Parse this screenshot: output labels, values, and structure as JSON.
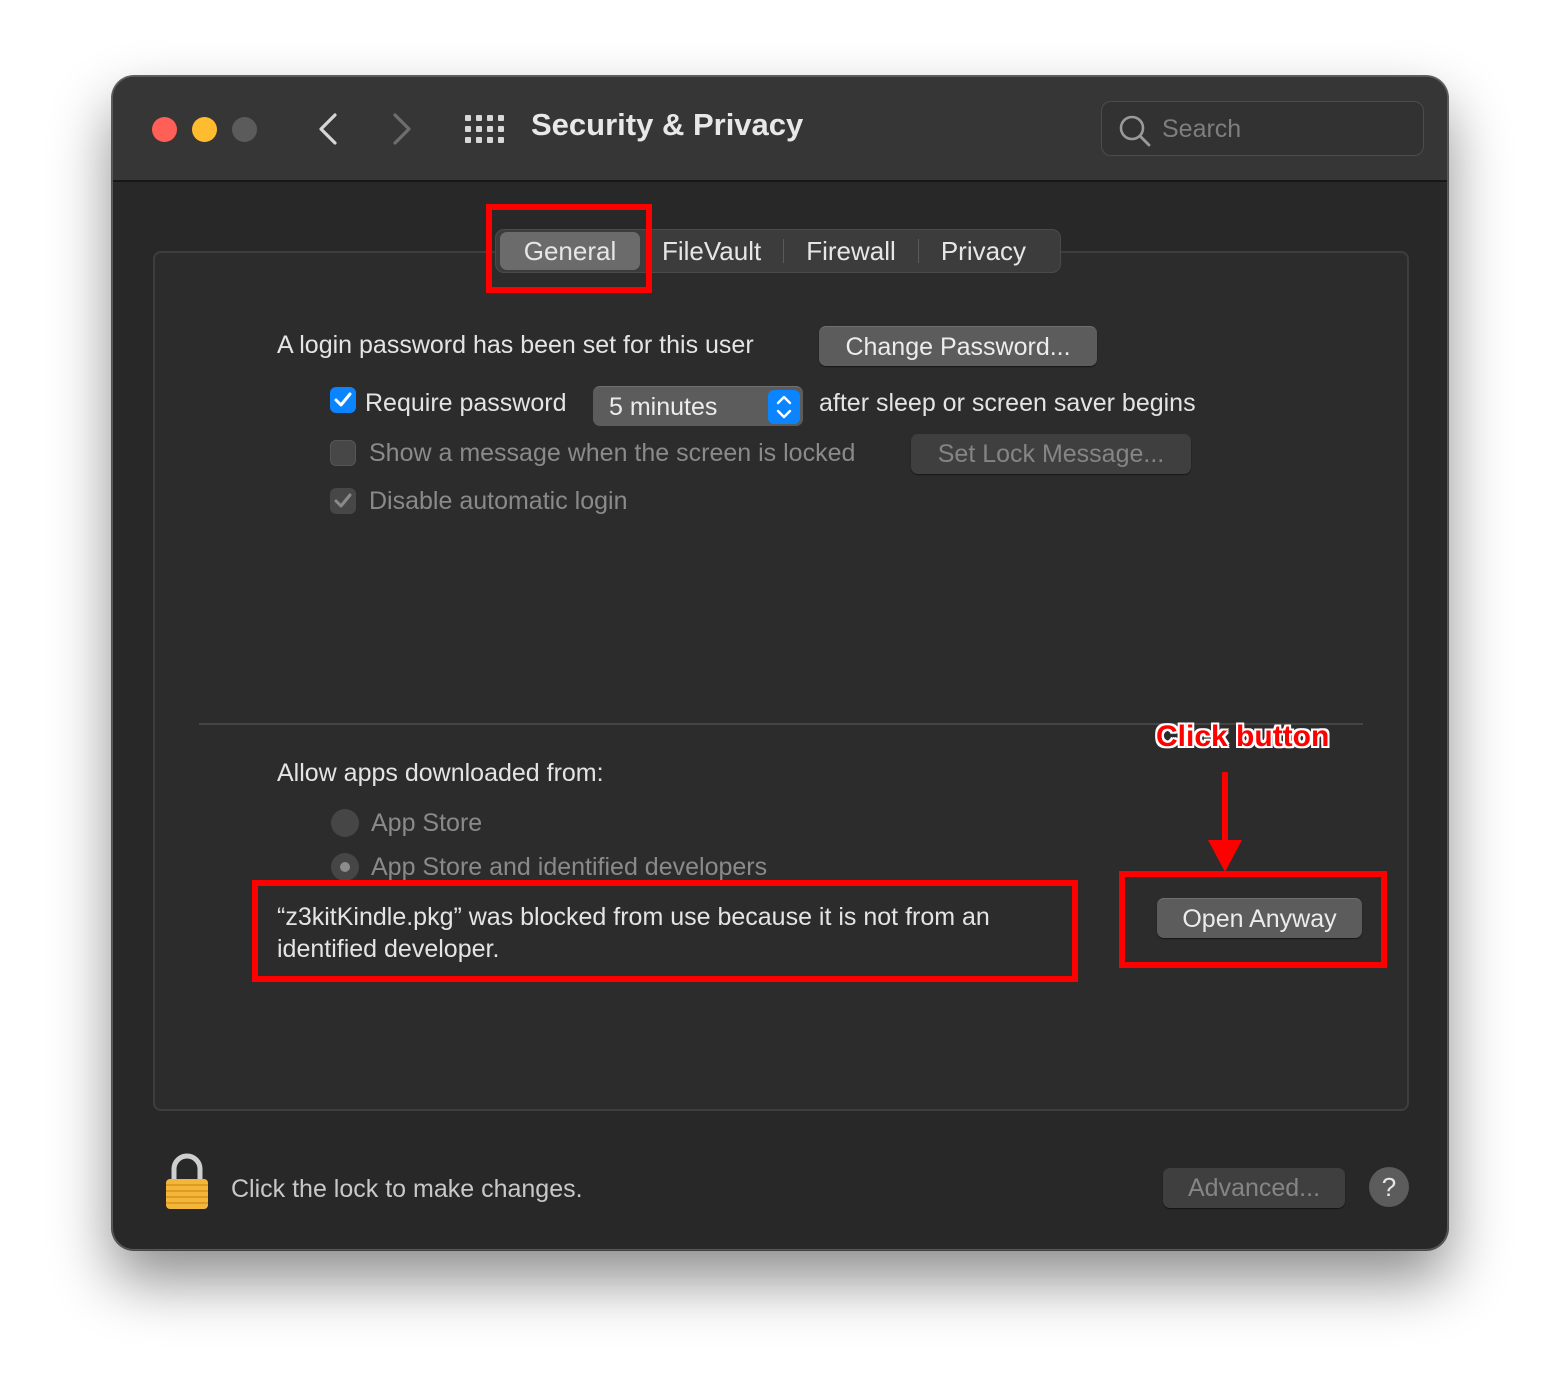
{
  "window": {
    "title": "Security & Privacy",
    "search_placeholder": "Search"
  },
  "tabs": [
    {
      "label": "General",
      "selected": true
    },
    {
      "label": "FileVault",
      "selected": false
    },
    {
      "label": "Firewall",
      "selected": false
    },
    {
      "label": "Privacy",
      "selected": false
    }
  ],
  "general": {
    "login_password_text": "A login password has been set for this user",
    "change_password_button": "Change Password...",
    "require_password": {
      "label": "Require password",
      "checked": true
    },
    "require_password_delay": "5 minutes",
    "after_sleep_text": "after sleep or screen saver begins",
    "show_message": {
      "label": "Show a message when the screen is locked",
      "checked": false
    },
    "set_lock_message_button": "Set Lock Message...",
    "disable_auto_login": {
      "label": "Disable automatic login",
      "checked": true
    },
    "allow_apps_heading": "Allow apps downloaded from:",
    "radio_options": [
      {
        "label": "App Store",
        "selected": false
      },
      {
        "label": "App Store and identified developers",
        "selected": true
      }
    ],
    "blocked_message_line1": "“z3kitKindle.pkg” was blocked from use because it is not from an",
    "blocked_message_line2": "identified developer.",
    "open_anyway_button": "Open Anyway"
  },
  "footer": {
    "lock_text": "Click the lock to make changes.",
    "advanced_button": "Advanced...",
    "help_button": "?"
  },
  "annotation": {
    "label": "Click button",
    "color": "#ff0000"
  },
  "colors": {
    "accent": "#0a84ff",
    "window_bg": "#282828",
    "close": "#fe5f57",
    "minimize": "#febc2e"
  }
}
